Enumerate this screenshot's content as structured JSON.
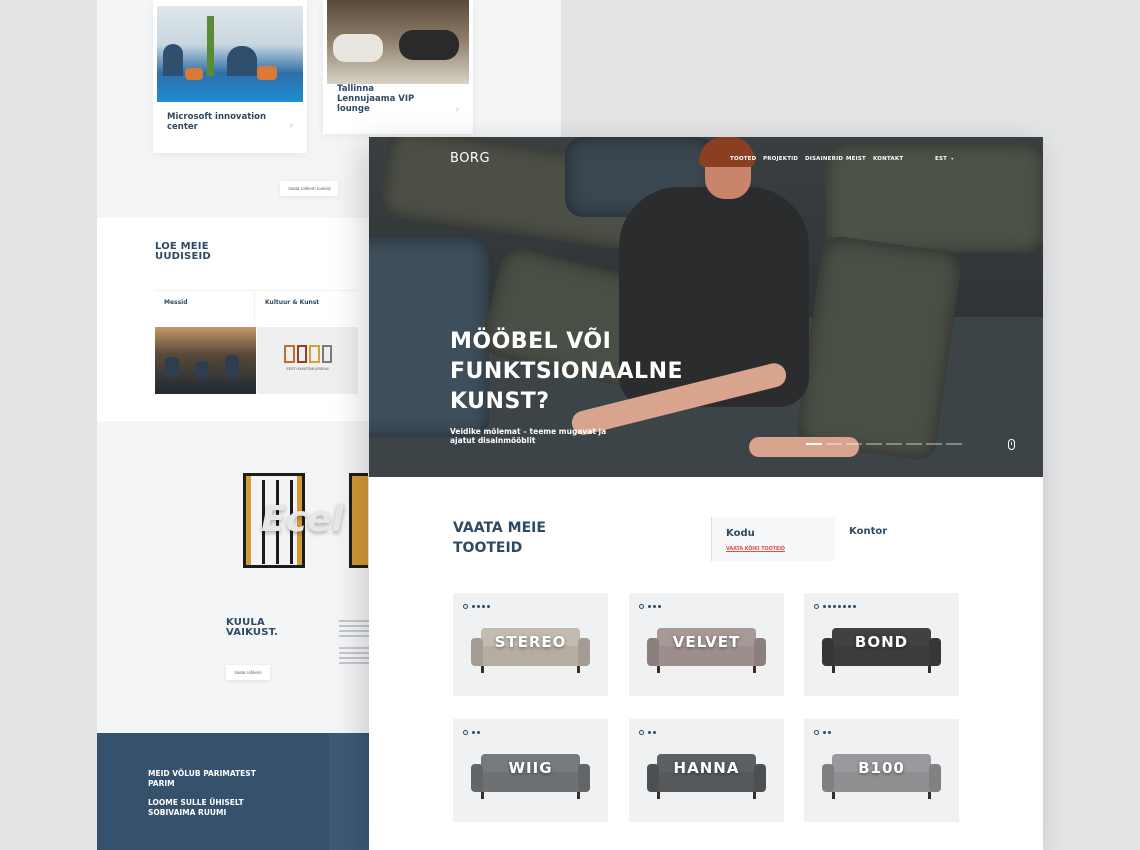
{
  "back_page": {
    "projects": [
      {
        "caption": "Microsoft innovation center"
      },
      {
        "caption": "Tallinna Lennujaama VIP lounge"
      }
    ],
    "projects_button": "Vaata rohkem tooteid",
    "news_heading": "LOE MEIE UUDISEID",
    "news_tabs": [
      "Messid",
      "Kultuur & Kunst"
    ],
    "museum_logo_text": "EESTI KUNSTIMUUSEUM",
    "brand_image_text": "Ecel",
    "kuula_heading": "KUULA VAIKUST.",
    "kuula_button": "Vaata rohkem",
    "footer_lines": [
      "MEID VÕLUB PARIMATEST PARIM",
      "LOOME SULLE ÜHISELT SOBIVAIMA RUUMI"
    ]
  },
  "front_page": {
    "logo": "BORG",
    "nav": [
      "TOOTED",
      "PROJEKTID",
      "DISAINERID",
      "MEIST",
      "KONTAKT"
    ],
    "language": "EST",
    "hero": {
      "title": "MÖÖBEL VÕI FUNKTSIONAALNE KUNST?",
      "subtitle": "Veidike mõlemat – teeme mugavat ja ajatut disainmööblit",
      "slides": 8,
      "active_slide": 1
    },
    "products": {
      "title": "VAATA MEIE TOOTEID",
      "tabs": [
        "Kodu",
        "Kontor"
      ],
      "active_tab": "Kodu",
      "all_link": "VAATA KÕIKI TOOTEID",
      "items": [
        {
          "name": "STEREO",
          "variants": 4,
          "sofa_color": "#b5ada2"
        },
        {
          "name": "VELVET",
          "variants": 3,
          "sofa_color": "#9c8e8c"
        },
        {
          "name": "BOND",
          "variants": 7,
          "sofa_color": "#3a3c3e"
        },
        {
          "name": "WIIG",
          "variants": 2,
          "sofa_color": "#6e7174"
        },
        {
          "name": "HANNA",
          "variants": 2,
          "sofa_color": "#56595b"
        },
        {
          "name": "B100",
          "variants": 2,
          "sofa_color": "#8d8f91"
        }
      ]
    }
  },
  "colors": {
    "navy": "#2e4a63",
    "accent_red": "#e2503f",
    "footer_blue": "#36516b"
  }
}
